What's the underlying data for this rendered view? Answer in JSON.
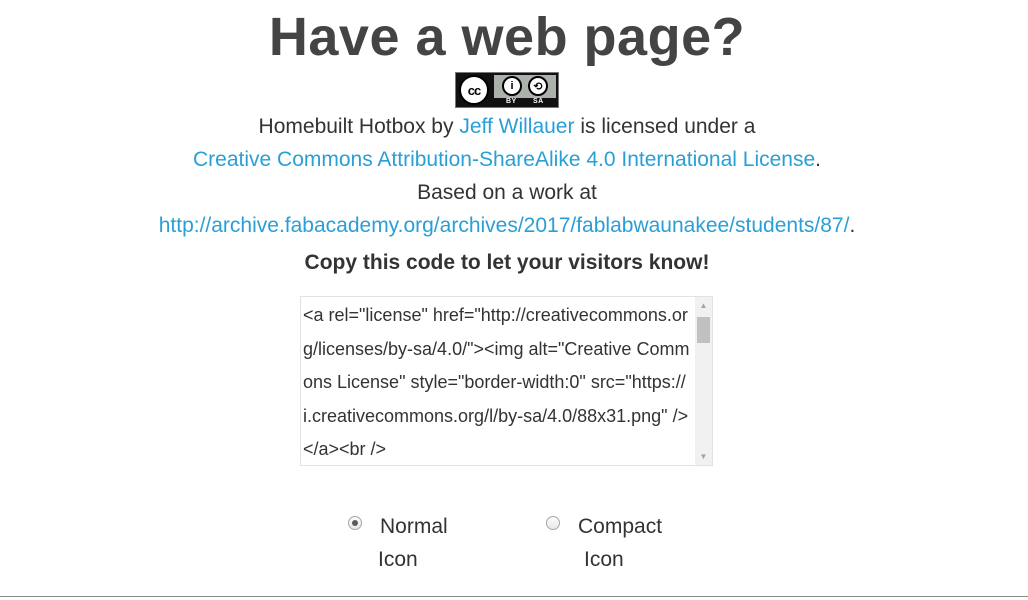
{
  "heading": "Have a web page?",
  "badge": {
    "cc": "cc",
    "by_symbol": "i",
    "sa_symbol": "⟲",
    "by_label": "BY",
    "sa_label": "SA"
  },
  "attribution": {
    "work_title": "Homebuilt Hotbox",
    "by_text": " by ",
    "author": "Jeff Willauer",
    "licensed_text": " is licensed under a ",
    "license_name": "Creative Commons Attribution-ShareAlike 4.0 International License",
    "period": ".",
    "based_on_text": "Based on a work at",
    "source_url": "http://archive.fabacademy.org/archives/2017/fablabwaunakee/students/87/",
    "period2": "."
  },
  "copy_prompt": "Copy this code to let your visitors know!",
  "code_snippet": "<a rel=\"license\" href=\"http://creativecommons.org/licenses/by-sa/4.0/\"><img alt=\"Creative Commons License\" style=\"border-width:0\" src=\"https://i.creativecommons.org/l/by-sa/4.0/88x31.png\" /></a><br />",
  "icon_options": {
    "normal": {
      "line1": "Normal",
      "line2": "Icon",
      "checked": true
    },
    "compact": {
      "line1": "Compact",
      "line2": "Icon",
      "checked": false
    }
  },
  "colors": {
    "link": "#2a9fd6",
    "text": "#333333"
  }
}
